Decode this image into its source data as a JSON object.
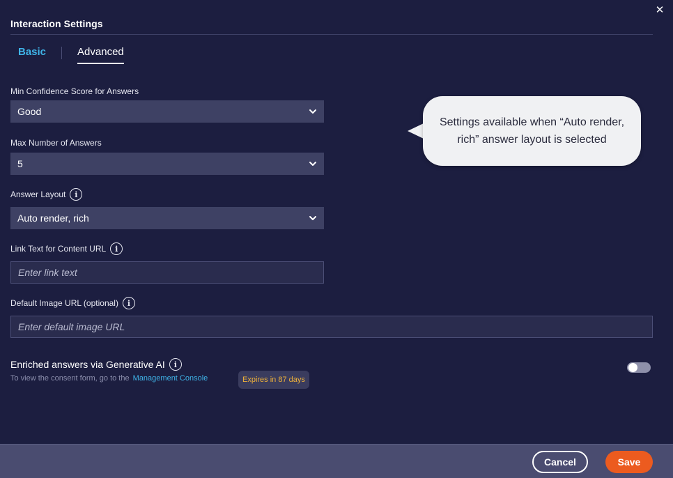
{
  "dialog": {
    "title": "Interaction Settings",
    "close_icon": "close-icon"
  },
  "tabs": [
    {
      "label": "Basic",
      "active": false
    },
    {
      "label": "Advanced",
      "active": true
    }
  ],
  "fields": {
    "min_confidence": {
      "label": "Min Confidence Score for Answers",
      "value": "Good"
    },
    "max_answers": {
      "label": "Max Number of Answers",
      "value": "5"
    },
    "answer_layout": {
      "label": "Answer Layout",
      "value": "Auto render, rich"
    },
    "link_text": {
      "label": "Link Text for Content URL",
      "placeholder": "Enter link text"
    },
    "default_image": {
      "label": "Default Image URL (optional)",
      "placeholder": "Enter default image URL"
    }
  },
  "tooltip": {
    "text": "Settings available when “Auto render, rich” answer layout is selected"
  },
  "generative_ai": {
    "title": "Enriched answers via Generative AI",
    "consent_text": "To view the consent form, go to the",
    "consent_link": "Management Console",
    "expires_badge": "Expires in 87 days",
    "toggle_on": false
  },
  "footer": {
    "cancel_label": "Cancel",
    "save_label": "Save"
  },
  "colors": {
    "background": "#1c1e40",
    "accent_link": "#3fb4e8",
    "save_button": "#ec5b1f",
    "badge_text": "#f0b23a"
  }
}
